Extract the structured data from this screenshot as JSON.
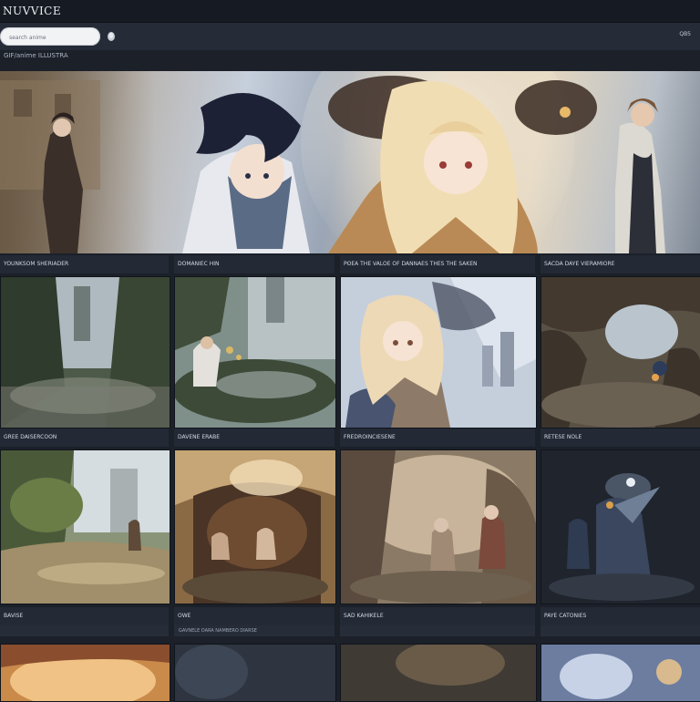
{
  "app": {
    "title": "NUVVICE"
  },
  "search": {
    "placeholder": "search anime",
    "menu_label": "QB5"
  },
  "section": {
    "label": "GIF/anime ILLUSTRA"
  },
  "hero": {
    "caption_left": "YOUNKSOM SHERIADER",
    "caption_mid": "DOMANIEC HIN",
    "caption_right": "POEA THE VALOE OF DANNAES THES THE SAKEN",
    "caption_far_right": "SACDA DAYE VIERAMIORE",
    "more_icon": "ellipsis-icon"
  },
  "row1": {
    "captions": [
      "GREE DAISERCOON",
      "DAVENE ERABE",
      "FREDROINCIESENE",
      "RETESE NOLE"
    ]
  },
  "row2": {
    "captions": [
      "BAVISE",
      "OWE",
      "SAD KAHIKELE",
      "PAYE CATONIES"
    ],
    "subcaptions": [
      "",
      "GAVNELE DARA NAMBERO DIARSE",
      "",
      ""
    ]
  },
  "colors": {
    "background": "#1b2029",
    "topbar": "#161a22",
    "caption_bg": "#232935"
  }
}
